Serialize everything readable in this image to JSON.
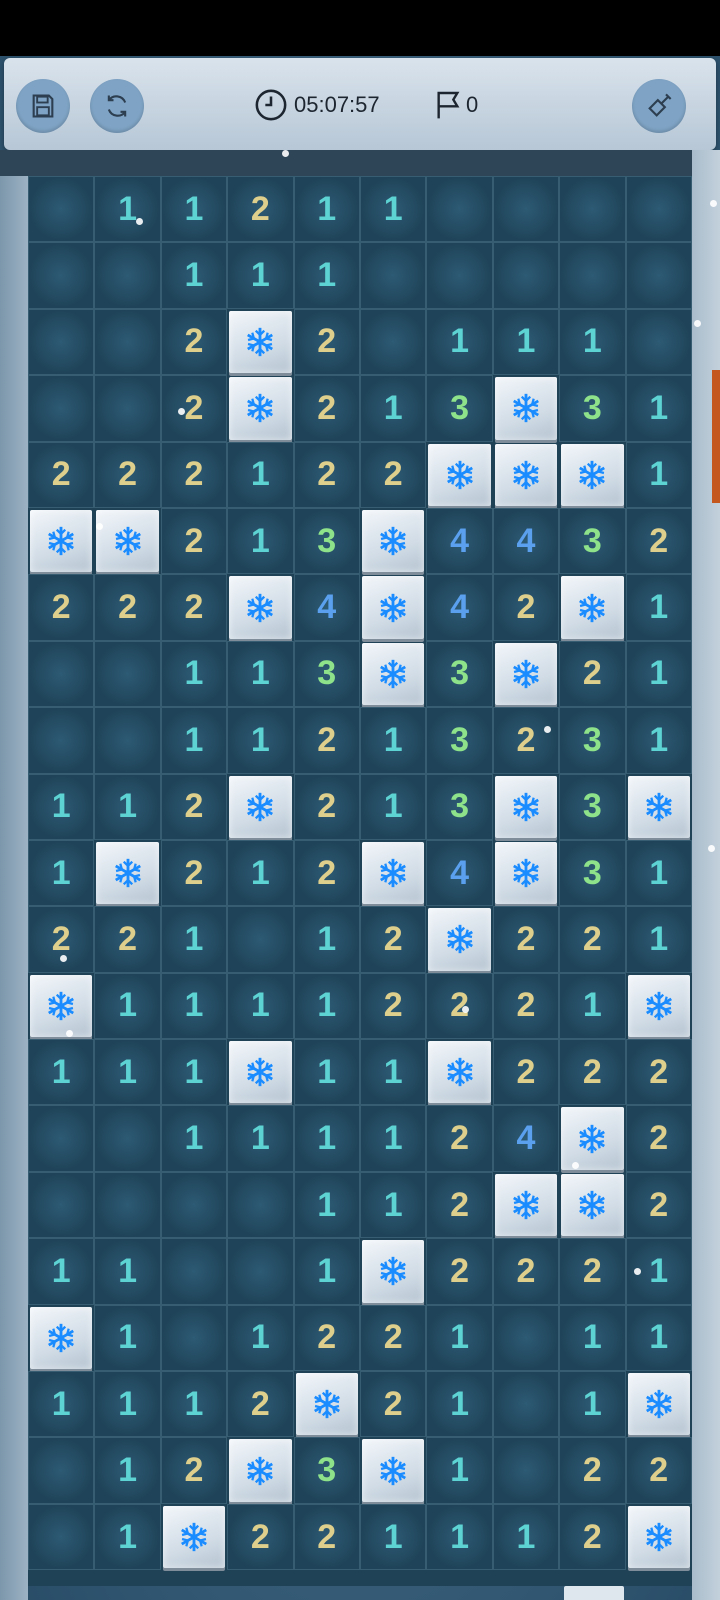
{
  "toolbar": {
    "save_icon": "save-icon",
    "restart_icon": "restart-icon",
    "timer": "05:07:57",
    "flags": "0",
    "shovel_icon": "shovel-icon"
  },
  "colors": {
    "n1": "#5ed3d3",
    "n2": "#dfcf8c",
    "n3": "#8ee38a",
    "n4": "#5aa0ee",
    "mine_icon": "#1a8cff"
  },
  "board": {
    "columns": 10,
    "rows": [
      [
        "",
        "1",
        "1",
        "2",
        "1",
        "1",
        "",
        "",
        "",
        ""
      ],
      [
        "",
        "",
        "1",
        "1",
        "1",
        "",
        "",
        "",
        "",
        ""
      ],
      [
        "",
        "",
        "2",
        "*",
        "2",
        "",
        "1",
        "1",
        "1",
        ""
      ],
      [
        "",
        "",
        "2",
        "*",
        "2",
        "1",
        "3",
        "*",
        "3",
        "1"
      ],
      [
        "2",
        "2",
        "2",
        "1",
        "2",
        "2",
        "*",
        "*",
        "*",
        "1"
      ],
      [
        "*",
        "*",
        "2",
        "1",
        "3",
        "*",
        "4",
        "4",
        "3",
        "2"
      ],
      [
        "2",
        "2",
        "2",
        "*",
        "4",
        "*",
        "4",
        "2",
        "*",
        "1"
      ],
      [
        "",
        "",
        "1",
        "1",
        "3",
        "*",
        "3",
        "*",
        "2",
        "1"
      ],
      [
        "",
        "",
        "1",
        "1",
        "2",
        "1",
        "3",
        "2",
        "3",
        "1"
      ],
      [
        "1",
        "1",
        "2",
        "*",
        "2",
        "1",
        "3",
        "*",
        "3",
        "*"
      ],
      [
        "1",
        "*",
        "2",
        "1",
        "2",
        "*",
        "4",
        "*",
        "3",
        "1"
      ],
      [
        "2",
        "2",
        "1",
        "",
        "1",
        "2",
        "*",
        "2",
        "2",
        "1"
      ],
      [
        "*",
        "1",
        "1",
        "1",
        "1",
        "2",
        "2",
        "2",
        "1",
        "*"
      ],
      [
        "1",
        "1",
        "1",
        "*",
        "1",
        "1",
        "*",
        "2",
        "2",
        "2"
      ],
      [
        "",
        "",
        "1",
        "1",
        "1",
        "1",
        "2",
        "4",
        "*",
        "2"
      ],
      [
        "",
        "",
        "",
        "",
        "1",
        "1",
        "2",
        "*",
        "*",
        "2"
      ],
      [
        "1",
        "1",
        "",
        "",
        "1",
        "*",
        "2",
        "2",
        "2",
        "1"
      ],
      [
        "*",
        "1",
        "",
        "1",
        "2",
        "2",
        "1",
        "",
        "1",
        "1"
      ],
      [
        "1",
        "1",
        "1",
        "2",
        "*",
        "2",
        "1",
        "",
        "1",
        "*"
      ],
      [
        "",
        "1",
        "2",
        "*",
        "3",
        "*",
        "1",
        "",
        "2",
        "2"
      ],
      [
        "",
        "1",
        "*",
        "2",
        "2",
        "1",
        "1",
        "1",
        "2",
        "*"
      ]
    ]
  }
}
